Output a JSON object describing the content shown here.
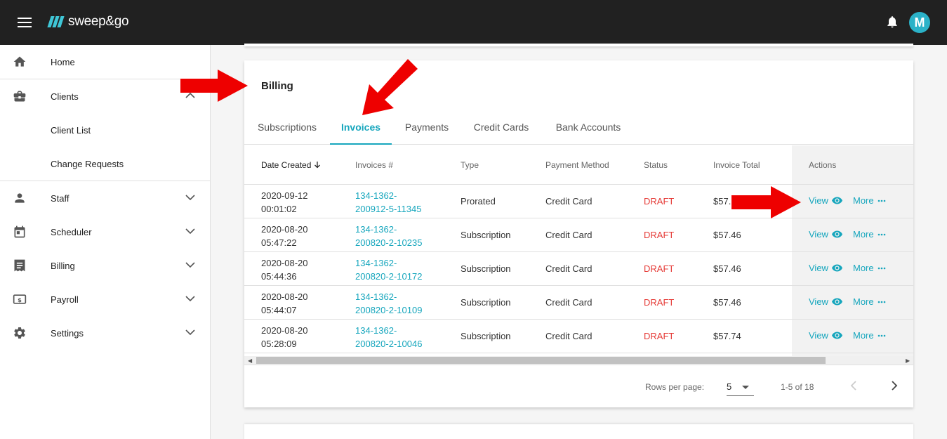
{
  "header": {
    "logo_text": "sweep&go",
    "avatar_initial": "M",
    "brand_color": "#16a6bd",
    "bar_color": "#212121"
  },
  "sidebar": {
    "items": [
      {
        "label": "Home",
        "icon": "home-icon"
      },
      {
        "label": "Clients",
        "icon": "briefcase-icon",
        "expanded": true
      },
      {
        "label": "Client List"
      },
      {
        "label": "Change Requests"
      },
      {
        "label": "Staff",
        "icon": "person-icon"
      },
      {
        "label": "Scheduler",
        "icon": "calendar-icon"
      },
      {
        "label": "Billing",
        "icon": "receipt-icon"
      },
      {
        "label": "Payroll",
        "icon": "payroll-icon"
      },
      {
        "label": "Settings",
        "icon": "gear-icon"
      }
    ]
  },
  "billing": {
    "title": "Billing",
    "tabs": [
      "Subscriptions",
      "Invoices",
      "Payments",
      "Credit Cards",
      "Bank Accounts"
    ],
    "active_tab": "Invoices"
  },
  "table": {
    "columns": [
      "Date Created",
      "Invoices #",
      "Type",
      "Payment Method",
      "Status",
      "Invoice Total",
      "Actions"
    ],
    "sorted_column": "Date Created",
    "rows": [
      {
        "date": "2020-09-12",
        "time": "00:01:02",
        "inv1": "134-1362-",
        "inv2": "200912-5-11345",
        "type": "Prorated",
        "method": "Credit Card",
        "status": "DRAFT",
        "total": "$57."
      },
      {
        "date": "2020-08-20",
        "time": "05:47:22",
        "inv1": "134-1362-",
        "inv2": "200820-2-10235",
        "type": "Subscription",
        "method": "Credit Card",
        "status": "DRAFT",
        "total": "$57.46"
      },
      {
        "date": "2020-08-20",
        "time": "05:44:36",
        "inv1": "134-1362-",
        "inv2": "200820-2-10172",
        "type": "Subscription",
        "method": "Credit Card",
        "status": "DRAFT",
        "total": "$57.46"
      },
      {
        "date": "2020-08-20",
        "time": "05:44:07",
        "inv1": "134-1362-",
        "inv2": "200820-2-10109",
        "type": "Subscription",
        "method": "Credit Card",
        "status": "DRAFT",
        "total": "$57.46"
      },
      {
        "date": "2020-08-20",
        "time": "05:28:09",
        "inv1": "134-1362-",
        "inv2": "200820-2-10046",
        "type": "Subscription",
        "method": "Credit Card",
        "status": "DRAFT",
        "total": "$57.74"
      }
    ],
    "view_label": "View",
    "more_label": "More",
    "status_color": "#e53935"
  },
  "footer": {
    "rows_per_page_label": "Rows per page:",
    "rows_per_page_value": "5",
    "range": "1-5 of 18"
  }
}
